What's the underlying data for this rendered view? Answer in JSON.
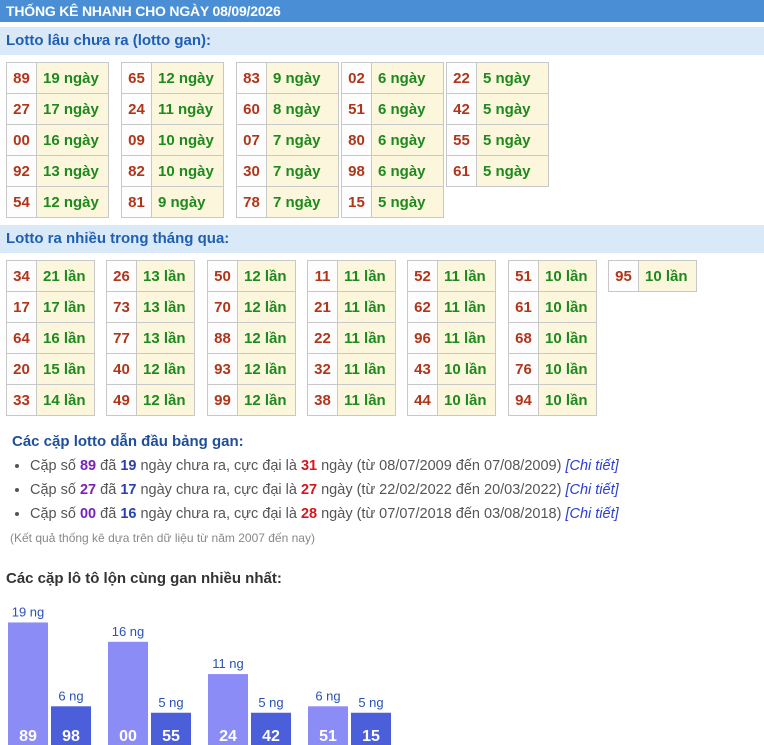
{
  "header": {
    "title": "THỐNG KÊ NHANH CHO NGÀY 08/09/2026"
  },
  "gan_section": {
    "title": "Lotto lâu chưa ra (lotto gan):",
    "groups": [
      [
        [
          "89",
          "19 ngày"
        ],
        [
          "27",
          "17 ngày"
        ],
        [
          "00",
          "16 ngày"
        ],
        [
          "92",
          "13 ngày"
        ],
        [
          "54",
          "12 ngày"
        ]
      ],
      [
        [
          "65",
          "12 ngày"
        ],
        [
          "24",
          "11 ngày"
        ],
        [
          "09",
          "10 ngày"
        ],
        [
          "82",
          "10 ngày"
        ],
        [
          "81",
          "9 ngày"
        ]
      ],
      [
        [
          "83",
          "9 ngày"
        ],
        [
          "60",
          "8 ngày"
        ],
        [
          "07",
          "7 ngày"
        ],
        [
          "30",
          "7 ngày"
        ],
        [
          "78",
          "7 ngày"
        ]
      ],
      [
        [
          "02",
          "6 ngày"
        ],
        [
          "51",
          "6 ngày"
        ],
        [
          "80",
          "6 ngày"
        ],
        [
          "98",
          "6 ngày"
        ],
        [
          "15",
          "5 ngày"
        ]
      ],
      [
        [
          "22",
          "5 ngày"
        ],
        [
          "42",
          "5 ngày"
        ],
        [
          "55",
          "5 ngày"
        ],
        [
          "61",
          "5 ngày"
        ]
      ]
    ]
  },
  "nhieu_section": {
    "title": "Lotto ra nhiều trong tháng qua:",
    "groups": [
      [
        [
          "34",
          "21 lần"
        ],
        [
          "17",
          "17 lần"
        ],
        [
          "64",
          "16 lần"
        ],
        [
          "20",
          "15 lần"
        ],
        [
          "33",
          "14 lần"
        ]
      ],
      [
        [
          "26",
          "13 lần"
        ],
        [
          "73",
          "13 lần"
        ],
        [
          "77",
          "13 lần"
        ],
        [
          "40",
          "12 lần"
        ],
        [
          "49",
          "12 lần"
        ]
      ],
      [
        [
          "50",
          "12 lần"
        ],
        [
          "70",
          "12 lần"
        ],
        [
          "88",
          "12 lần"
        ],
        [
          "93",
          "12 lần"
        ],
        [
          "99",
          "12 lần"
        ]
      ],
      [
        [
          "11",
          "11 lần"
        ],
        [
          "21",
          "11 lần"
        ],
        [
          "22",
          "11 lần"
        ],
        [
          "32",
          "11 lần"
        ],
        [
          "38",
          "11 lần"
        ]
      ],
      [
        [
          "52",
          "11 lần"
        ],
        [
          "62",
          "11 lần"
        ],
        [
          "96",
          "11 lần"
        ],
        [
          "43",
          "10 lần"
        ],
        [
          "44",
          "10 lần"
        ]
      ],
      [
        [
          "51",
          "10 lần"
        ],
        [
          "61",
          "10 lần"
        ],
        [
          "68",
          "10 lần"
        ],
        [
          "76",
          "10 lần"
        ],
        [
          "94",
          "10 lần"
        ]
      ],
      [
        [
          "95",
          "10 lần"
        ]
      ]
    ]
  },
  "lead": {
    "title": "Các cặp lotto dẫn đầu bảng gan:",
    "items": [
      {
        "p1": "Cặp số ",
        "num": "89",
        "p2": " đã ",
        "days": "19",
        "p3": " ngày chưa ra, cực đại là ",
        "max": "31",
        "p4": " ngày (từ 08/07/2009 đến 07/08/2009) ",
        "link": "[Chi tiết]"
      },
      {
        "p1": "Cặp số ",
        "num": "27",
        "p2": " đã ",
        "days": "17",
        "p3": " ngày chưa ra, cực đại là ",
        "max": "27",
        "p4": " ngày (từ 22/02/2022 đến 20/03/2022) ",
        "link": "[Chi tiết]"
      },
      {
        "p1": "Cặp số ",
        "num": "00",
        "p2": " đã ",
        "days": "16",
        "p3": " ngày chưa ra, cực đại là ",
        "max": "28",
        "p4": " ngày (từ 07/07/2018 đến 03/08/2018) ",
        "link": "[Chi tiết]"
      }
    ],
    "note": "(Kết quả thống kê dựa trên dữ liệu từ năm 2007 đến nay)"
  },
  "chart_section": {
    "title": "Các cặp lô tô lộn cùng gan nhiều nhất:"
  },
  "chart_data": {
    "type": "bar",
    "categories": [
      "89",
      "98",
      "00",
      "55",
      "24",
      "42",
      "51",
      "15"
    ],
    "values": [
      19,
      6,
      16,
      5,
      11,
      5,
      6,
      5
    ],
    "value_labels": [
      "19 ng",
      "6 ng",
      "16 ng",
      "5 ng",
      "11 ng",
      "5 ng",
      "6 ng",
      "5 ng"
    ],
    "colors": {
      "first": "#8c8cf7",
      "second": "#4a5fd9",
      "label": "#2a52b8"
    }
  }
}
